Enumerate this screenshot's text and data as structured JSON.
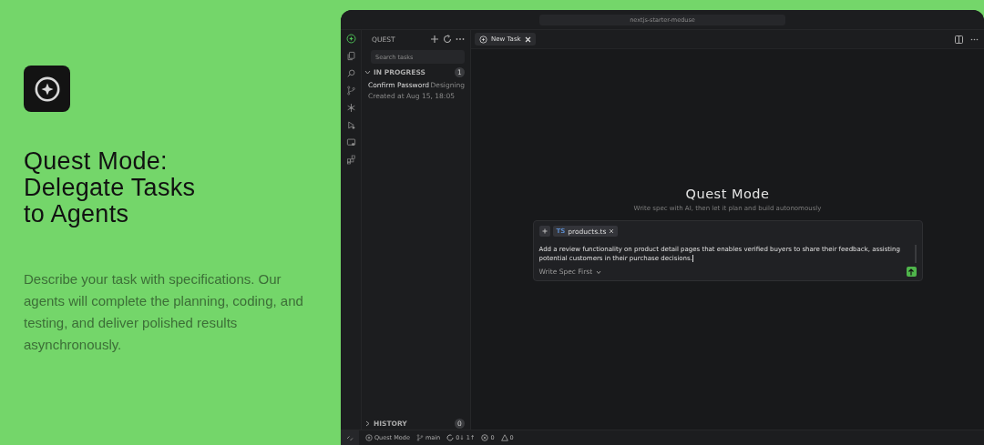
{
  "hero": {
    "title_lines": [
      "Quest Mode:",
      "Delegate Tasks",
      "to Agents"
    ],
    "description": "Describe your task with specifications. Our agents will complete the planning, coding, and testing, and deliver polished results asynchronously."
  },
  "window": {
    "title": "nextjs-starter-meduse"
  },
  "activity_bar": [
    {
      "kind": "quest",
      "selected": true
    },
    {
      "kind": "files",
      "selected": false
    },
    {
      "kind": "search",
      "selected": false
    },
    {
      "kind": "branch",
      "selected": false
    },
    {
      "kind": "snow",
      "selected": false
    },
    {
      "kind": "run",
      "selected": false
    },
    {
      "kind": "remote",
      "selected": false
    },
    {
      "kind": "extensions",
      "selected": false
    }
  ],
  "sidebar": {
    "title": "QUEST",
    "search": {
      "placeholder": "Search tasks"
    },
    "in_progress": {
      "label": "IN PROGRESS",
      "count": "1",
      "expanded": true,
      "tasks": [
        {
          "name": "Confirm Password",
          "status": "Designing",
          "created": "Created at Aug 15, 18:05"
        }
      ]
    },
    "history": {
      "label": "HISTORY",
      "count": "0",
      "expanded": false
    }
  },
  "tabs": [
    {
      "label": "New Task",
      "selected": true
    }
  ],
  "quest": {
    "title": "Quest Mode",
    "subtitle": "Write spec with AI, then let it plan and build autonomously",
    "file_chip": {
      "badge": "TS",
      "name": "products.ts"
    },
    "prompt": "Add a review functionality on product detail pages that enables verified buyers to share their feedback, assisting potential customers in their purchase decisions.",
    "mode": "Write Spec First"
  },
  "status_bar": {
    "mode": "Quest Mode",
    "branch": "main",
    "sync": "0↓ 1↑",
    "errors": "0",
    "warnings": "0"
  }
}
